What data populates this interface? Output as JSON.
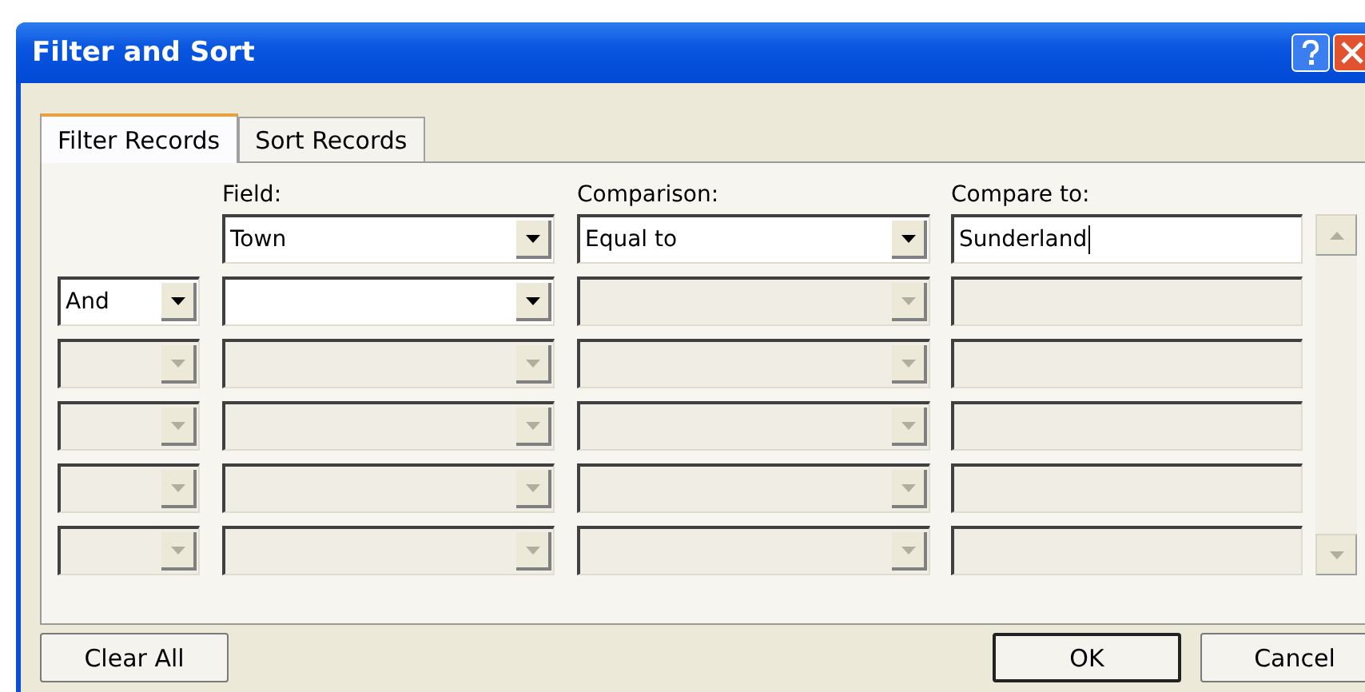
{
  "window": {
    "title": "Filter and Sort"
  },
  "tabs": [
    {
      "label": "Filter Records",
      "selected": true
    },
    {
      "label": "Sort Records",
      "selected": false
    }
  ],
  "columns": {
    "field": "Field:",
    "comparison": "Comparison:",
    "compare_to": "Compare to:"
  },
  "rows": [
    {
      "field": {
        "value": "Town",
        "disabled": false
      },
      "comparison": {
        "value": "Equal to",
        "disabled": false
      },
      "compare_to": {
        "value": "Sunderland",
        "disabled": false
      }
    },
    {
      "connector": {
        "value": "And",
        "disabled": false
      },
      "field": {
        "disabled": false
      },
      "comparison": {
        "disabled": true
      },
      "compare_to": {
        "disabled": true
      }
    },
    {
      "connector": {
        "disabled": true
      },
      "field": {
        "disabled": true
      },
      "comparison": {
        "disabled": true
      },
      "compare_to": {
        "disabled": true
      }
    },
    {
      "connector": {
        "disabled": true
      },
      "field": {
        "disabled": true
      },
      "comparison": {
        "disabled": true
      },
      "compare_to": {
        "disabled": true
      }
    },
    {
      "connector": {
        "disabled": true
      },
      "field": {
        "disabled": true
      },
      "comparison": {
        "disabled": true
      },
      "compare_to": {
        "disabled": true
      }
    },
    {
      "connector": {
        "disabled": true
      },
      "field": {
        "disabled": true
      },
      "comparison": {
        "disabled": true
      },
      "compare_to": {
        "disabled": true
      }
    }
  ],
  "buttons": {
    "clear": "Clear All",
    "ok": "OK",
    "cancel": "Cancel"
  }
}
